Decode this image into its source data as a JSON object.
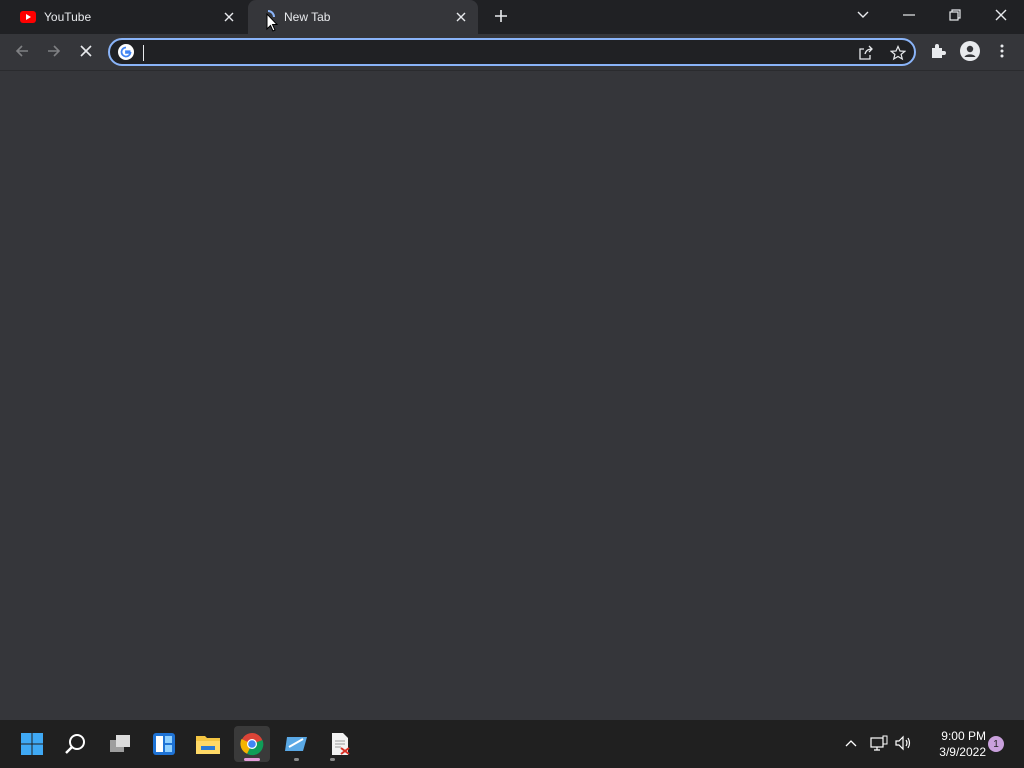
{
  "browser": {
    "tabs": [
      {
        "title": "YouTube",
        "favicon": "youtube-icon",
        "active": false
      },
      {
        "title": "New Tab",
        "favicon": "loading-icon",
        "active": true
      }
    ],
    "address_bar": {
      "value": "",
      "placeholder": ""
    }
  },
  "taskbar": {
    "time": "9:00 PM",
    "date": "3/9/2022",
    "notification_count": "1"
  },
  "colors": {
    "accent": "#8ab4f8",
    "titlebar_bg": "#202124",
    "toolbar_bg": "#35363a",
    "taskbar_bg": "#202020"
  }
}
